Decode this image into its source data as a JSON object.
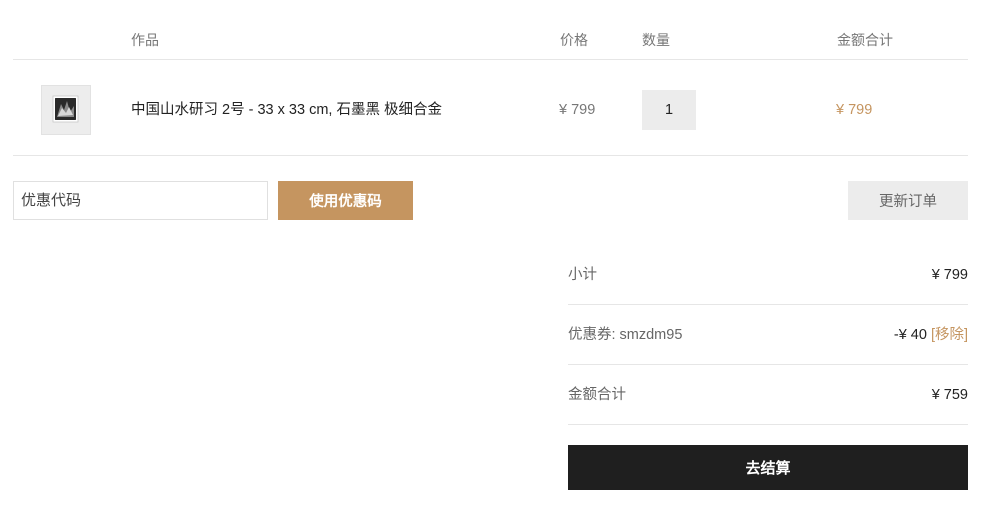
{
  "cart": {
    "columns": {
      "product": "作品",
      "price": "价格",
      "quantity": "数量",
      "total": "金额合计"
    },
    "items": [
      {
        "name": "中国山水研习 2号 - 33 x 33 cm, 石墨黑 极细合金",
        "price": "¥ 799",
        "quantity": "1",
        "total": "¥ 799",
        "thumbnail_icon": "framed-artwork-thumbnail"
      }
    ]
  },
  "coupon": {
    "placeholder": "优惠代码",
    "apply_label": "使用优惠码",
    "update_label": "更新订单"
  },
  "totals": {
    "subtotal_label": "小计",
    "subtotal_value": "¥ 799",
    "coupon_label": "优惠券:",
    "coupon_code": "smzdm95",
    "coupon_value": "-¥ 40",
    "remove_label": "[移除]",
    "grand_total_label": "金额合计",
    "grand_total_value": "¥ 759"
  },
  "checkout": {
    "label": "去结算"
  },
  "colors": {
    "accent": "#c59560",
    "checkout_bg": "#1f1f1f",
    "muted_button_bg": "#ececec"
  }
}
